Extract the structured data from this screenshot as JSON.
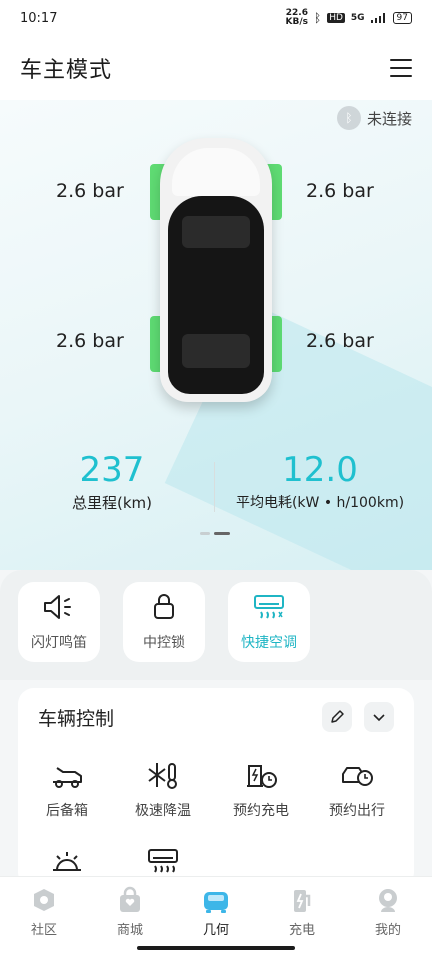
{
  "status": {
    "time": "10:17",
    "net_speed_top": "22.6",
    "net_speed_unit": "KB/s",
    "network": "5G",
    "battery": "97"
  },
  "header": {
    "title": "车主模式"
  },
  "bluetooth": {
    "status": "未连接"
  },
  "tire_pressure": {
    "front_left": "2.6 bar",
    "front_right": "2.6 bar",
    "rear_left": "2.6 bar",
    "rear_right": "2.6 bar"
  },
  "stats": {
    "mileage_value": "237",
    "mileage_label": "总里程(km)",
    "consumption_value": "12.0",
    "consumption_label": "平均电耗(kW • h/100km)"
  },
  "quick_actions": [
    {
      "label": "闪灯鸣笛",
      "icon": "speaker-horn-icon"
    },
    {
      "label": "中控锁",
      "icon": "lock-icon"
    },
    {
      "label": "快捷空调",
      "icon": "air-conditioner-icon",
      "active": true
    }
  ],
  "vehicle_control": {
    "title": "车辆控制",
    "items": [
      {
        "label": "后备箱",
        "icon": "trunk-icon"
      },
      {
        "label": "极速降温",
        "icon": "snowflake-thermometer-icon"
      },
      {
        "label": "预约充电",
        "icon": "scheduled-charge-icon"
      },
      {
        "label": "预约出行",
        "icon": "scheduled-trip-icon"
      }
    ]
  },
  "tabbar": [
    {
      "label": "社区",
      "icon": "community-icon"
    },
    {
      "label": "商城",
      "icon": "shop-icon"
    },
    {
      "label": "几何",
      "icon": "car-icon",
      "active": true
    },
    {
      "label": "充电",
      "icon": "charging-icon"
    },
    {
      "label": "我的",
      "icon": "profile-icon"
    }
  ],
  "colors": {
    "accent": "#1fc0cf",
    "tire_ok": "#56d96b"
  }
}
